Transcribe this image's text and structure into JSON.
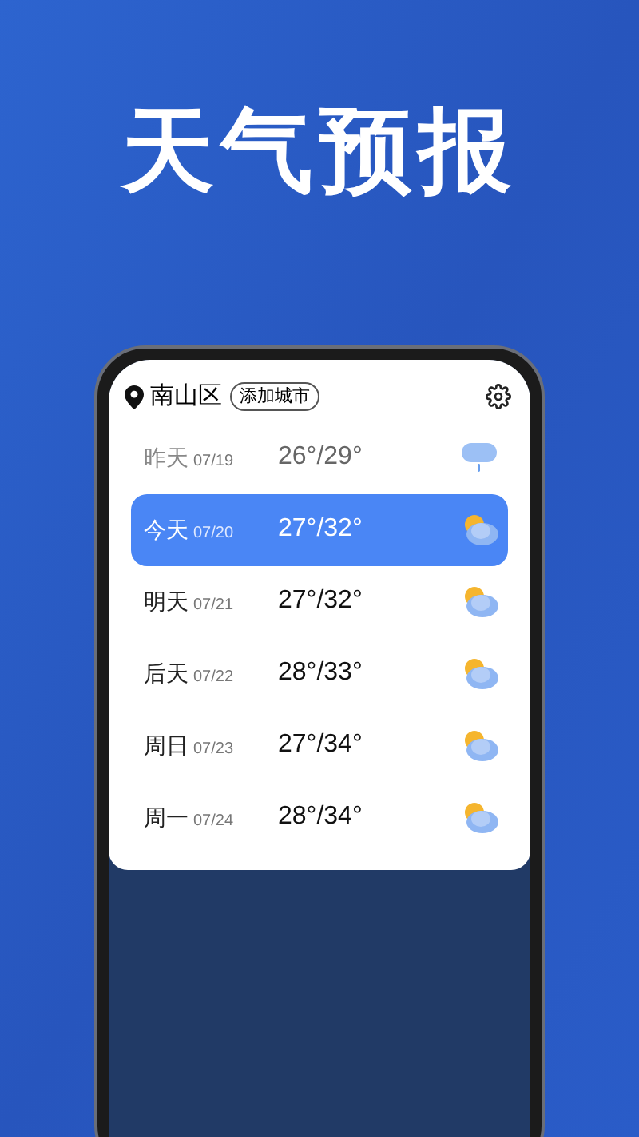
{
  "headline": "天气预报",
  "header": {
    "location": "南山区",
    "add_city_button": "添加城市"
  },
  "days": [
    {
      "day": "昨天",
      "date": "07/19",
      "temps": "26°/29°",
      "kind": "rain",
      "selected": false,
      "past": true
    },
    {
      "day": "今天",
      "date": "07/20",
      "temps": "27°/32°",
      "kind": "partly-cloudy",
      "selected": true,
      "past": false
    },
    {
      "day": "明天",
      "date": "07/21",
      "temps": "27°/32°",
      "kind": "partly-cloudy",
      "selected": false,
      "past": false
    },
    {
      "day": "后天",
      "date": "07/22",
      "temps": "28°/33°",
      "kind": "partly-cloudy",
      "selected": false,
      "past": false
    },
    {
      "day": "周日",
      "date": "07/23",
      "temps": "27°/34°",
      "kind": "partly-cloudy",
      "selected": false,
      "past": false
    },
    {
      "day": "周一",
      "date": "07/24",
      "temps": "28°/34°",
      "kind": "partly-cloudy",
      "selected": false,
      "past": false
    }
  ]
}
